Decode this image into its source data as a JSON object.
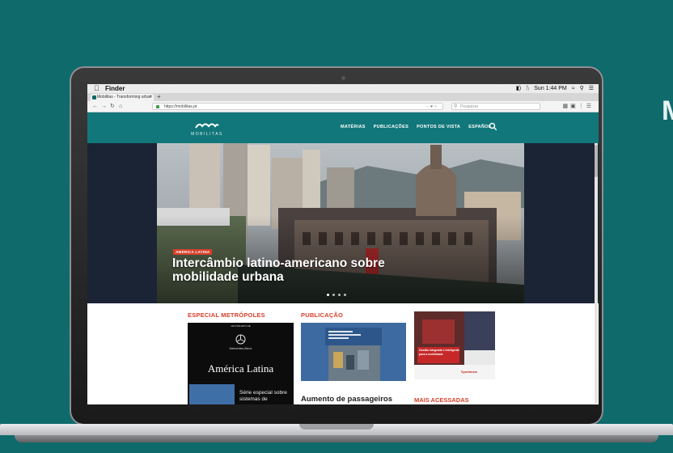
{
  "corner_text": "M",
  "menubar": {
    "apple": "",
    "app_name": "Finder",
    "clock": "Sun 1:44 PM"
  },
  "browser": {
    "tab_title": "Mobilitas - Transforming urban",
    "tab_close": "×",
    "new_tab": "+",
    "url": "https://mobilitas.pt",
    "url_actions": "··· ♥ ☆",
    "search_placeholder": "Pesquisar"
  },
  "site": {
    "logo_text": "MOBILITAS",
    "nav": [
      "MATÉRIAS",
      "PUBLICAÇÕES",
      "PONTOS DE VISTA",
      "ESPAÑOL"
    ],
    "hero": {
      "kicker": "AMÉRICA LATINA",
      "title": "Intercâmbio latino-americano sobre mobilidade urbana"
    },
    "cards": [
      {
        "heading": "ESPECIAL METRÓPOLES",
        "brand": "Mercedes-Benz",
        "overline": "UM PROJETO DE",
        "title": "América Latina",
        "caption": "Série especial sobre sistemas de"
      },
      {
        "heading": "PUBLICAÇÃO",
        "caption": "Aumento de passageiros"
      },
      {
        "heading": "",
        "promo": "Gestão integrada e inteligente para a mobilidade",
        "brand": "Symbiosis",
        "caption": "MAIS ACESSADAS"
      }
    ]
  },
  "colors": {
    "brand_teal": "#12777a",
    "background_teal": "#0f6a6c",
    "accent_red": "#d7402b",
    "hero_side": "#1b2434"
  }
}
